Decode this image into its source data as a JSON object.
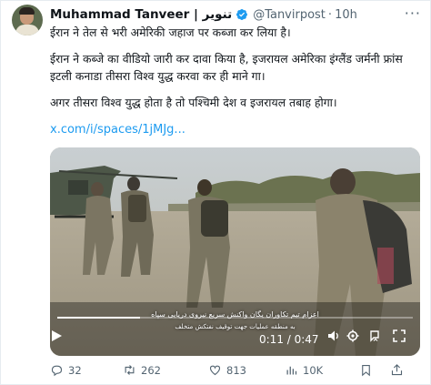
{
  "author": {
    "name": "Muhammad Tanveer | تنویر",
    "handle": "@Tanvirpost",
    "separator": "·",
    "time": "10h"
  },
  "tweet": {
    "line1": "ईरान ने तेल से भरी अमेरिकी जहाज पर कब्जा कर लिया है।",
    "line2": "ईरान ने कब्जे का वीडियो जारी कर दावा किया है, इजरायल अमेरिका इंग्लैंड जर्मनी फ्रांस",
    "line3": "इटली कनाडा तीसरा विश्व युद्ध करवा कर ही माने गा।",
    "line4": "अगर तीसरा विश्व युद्ध होता है तो पश्चिमी देश व इजरायल तबाह होगा।",
    "link": "x.com/i/spaces/1jMJg..."
  },
  "video": {
    "subtitle1": "اعزام تیم تکاوران یگان واکنش سریع نیروی دریایی سپاه",
    "subtitle2": "به منطقه عملیات جهت توقیف نفتکش متخلف",
    "timecode": "0:11 / 0:47",
    "progress": 0.234
  },
  "actions": {
    "replies": "32",
    "reposts": "262",
    "likes": "813",
    "views": "10K"
  },
  "icons": [
    "verified-icon",
    "more-icon",
    "play-icon",
    "volume-icon",
    "settings-icon",
    "captions-icon",
    "fullscreen-icon",
    "reply-icon",
    "repost-icon",
    "like-icon",
    "views-icon",
    "bookmark-icon",
    "share-icon"
  ],
  "colors": {
    "accent": "#1d9bf0",
    "secondary_text": "#536471",
    "verified_badge": "#1d9bf0"
  }
}
